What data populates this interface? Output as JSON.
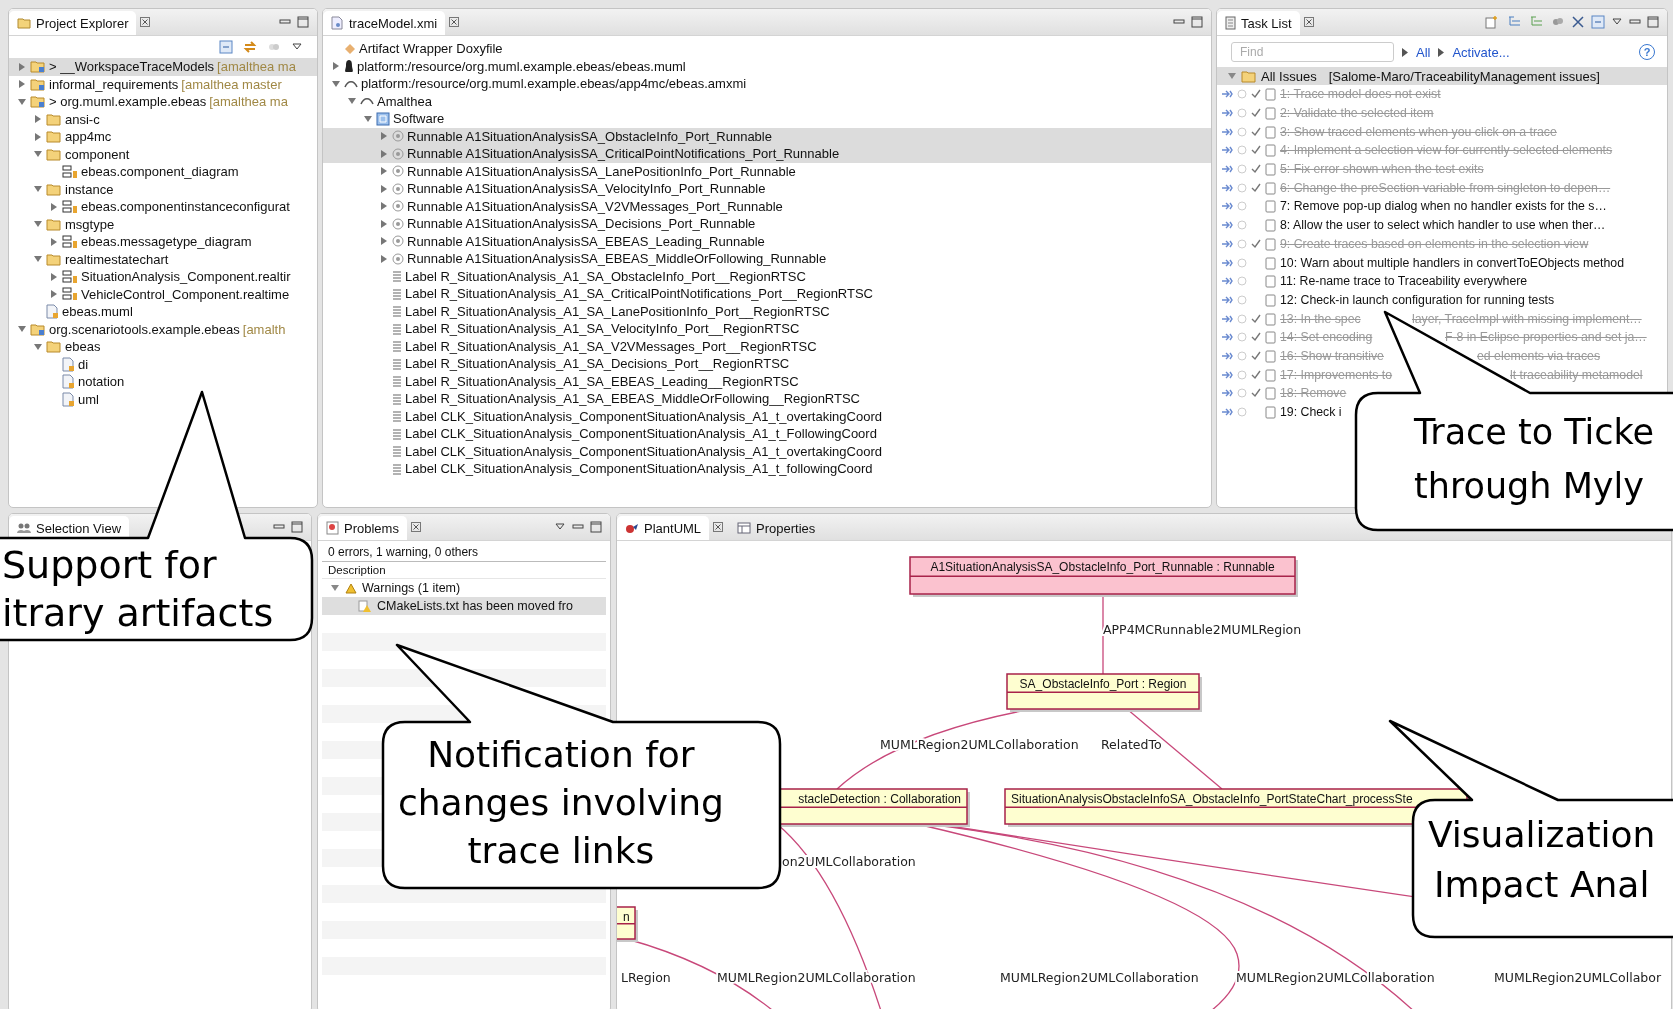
{
  "project_explorer": {
    "title": "Project Explorer",
    "items": [
      {
        "label": "> __WorkspaceTraceModels",
        "decoration": "[amalthea ma",
        "kind": "project",
        "expandable": true,
        "expanded": false,
        "selected": true
      },
      {
        "label": "informal_requirements",
        "decoration": "[amalthea master",
        "kind": "project",
        "expandable": true,
        "expanded": false,
        "selected": false
      },
      {
        "label": "> org.muml.example.ebeas",
        "decoration": "[amalthea ma",
        "kind": "project",
        "expandable": true,
        "expanded": true,
        "selected": false,
        "children": [
          {
            "label": "ansi-c",
            "kind": "folder",
            "expandable": true,
            "expanded": false,
            "selected": false
          },
          {
            "label": "app4mc",
            "kind": "folder",
            "expandable": true,
            "expanded": false,
            "selected": false
          },
          {
            "label": "component",
            "kind": "folder",
            "expandable": true,
            "expanded": true,
            "selected": false,
            "children": [
              {
                "label": "ebeas.component_diagram",
                "kind": "diagram",
                "expandable": false,
                "selected": false
              }
            ]
          },
          {
            "label": "instance",
            "kind": "folder",
            "expandable": true,
            "expanded": true,
            "selected": false,
            "children": [
              {
                "label": "ebeas.componentinstanceconfigurat",
                "kind": "diagram",
                "expandable": true,
                "expanded": false,
                "selected": false
              }
            ]
          },
          {
            "label": "msgtype",
            "kind": "folder",
            "expandable": true,
            "expanded": true,
            "selected": false,
            "children": [
              {
                "label": "ebeas.messagetype_diagram",
                "kind": "diagram",
                "expandable": true,
                "expanded": false,
                "selected": false
              }
            ]
          },
          {
            "label": "realtimestatechart",
            "kind": "folder",
            "expandable": true,
            "expanded": true,
            "selected": false,
            "children": [
              {
                "label": "SituationAnalysis_Component.realtir",
                "kind": "diagram",
                "expandable": true,
                "expanded": false,
                "selected": false
              },
              {
                "label": "VehicleControl_Component.realtime",
                "kind": "diagram",
                "expandable": true,
                "expanded": false,
                "selected": false
              }
            ]
          },
          {
            "label": "ebeas.muml",
            "kind": "file",
            "expandable": false,
            "selected": false
          }
        ]
      },
      {
        "label": "org.scenariotools.example.ebeas",
        "decoration": "[amalth",
        "kind": "project",
        "expandable": true,
        "expanded": true,
        "selected": false,
        "children": [
          {
            "label": "ebeas",
            "kind": "folder",
            "expandable": true,
            "expanded": true,
            "selected": false,
            "children": [
              {
                "label": "di",
                "kind": "file",
                "expandable": false,
                "selected": false
              },
              {
                "label": "notation",
                "kind": "file",
                "expandable": false,
                "selected": false
              },
              {
                "label": "uml",
                "kind": "file",
                "expandable": false,
                "selected": false
              }
            ]
          }
        ]
      }
    ]
  },
  "editor": {
    "tab": "traceModel.xmi",
    "items": [
      {
        "label": "Artifact Wrapper Doxyfile",
        "kind": "wrapper",
        "expandable": false,
        "selected": false
      },
      {
        "label": "platform:/resource/org.muml.example.ebeas/ebeas.muml",
        "kind": "resource",
        "expandable": true,
        "expanded": false,
        "selected": false
      },
      {
        "label": "platform:/resource/org.muml.example.ebeas/app4mc/ebeas.amxmi",
        "kind": "model",
        "expandable": true,
        "expanded": true,
        "selected": false,
        "children": [
          {
            "label": "Amalthea",
            "kind": "model",
            "expandable": true,
            "expanded": true,
            "selected": false,
            "children": [
              {
                "label": "Software",
                "kind": "package",
                "expandable": true,
                "expanded": true,
                "selected": false,
                "children": [
                  {
                    "label": "Runnable A1SituationAnalysisSA_ObstacleInfo_Port_Runnable",
                    "kind": "runnable",
                    "expandable": true,
                    "expanded": false,
                    "selected": true
                  },
                  {
                    "label": "Runnable A1SituationAnalysisSA_CriticalPointNotifications_Port_Runnable",
                    "kind": "runnable",
                    "expandable": true,
                    "expanded": false,
                    "selected": true
                  },
                  {
                    "label": "Runnable A1SituationAnalysisSA_LanePositionInfo_Port_Runnable",
                    "kind": "runnable",
                    "expandable": true,
                    "expanded": false,
                    "selected": false
                  },
                  {
                    "label": "Runnable A1SituationAnalysisSA_VelocityInfo_Port_Runnable",
                    "kind": "runnable",
                    "expandable": true,
                    "expanded": false,
                    "selected": false
                  },
                  {
                    "label": "Runnable A1SituationAnalysisSA_V2VMessages_Port_Runnable",
                    "kind": "runnable",
                    "expandable": true,
                    "expanded": false,
                    "selected": false
                  },
                  {
                    "label": "Runnable A1SituationAnalysisSA_Decisions_Port_Runnable",
                    "kind": "runnable",
                    "expandable": true,
                    "expanded": false,
                    "selected": false
                  },
                  {
                    "label": "Runnable A1SituationAnalysisSA_EBEAS_Leading_Runnable",
                    "kind": "runnable",
                    "expandable": true,
                    "expanded": false,
                    "selected": false
                  },
                  {
                    "label": "Runnable A1SituationAnalysisSA_EBEAS_MiddleOrFollowing_Runnable",
                    "kind": "runnable",
                    "expandable": true,
                    "expanded": false,
                    "selected": false
                  },
                  {
                    "label": "Label R_SituationAnalysis_A1_SA_ObstacleInfo_Port__RegionRTSC",
                    "kind": "label",
                    "expandable": false,
                    "selected": false
                  },
                  {
                    "label": "Label R_SituationAnalysis_A1_SA_CriticalPointNotifications_Port__RegionRTSC",
                    "kind": "label",
                    "expandable": false,
                    "selected": false
                  },
                  {
                    "label": "Label R_SituationAnalysis_A1_SA_LanePositionInfo_Port__RegionRTSC",
                    "kind": "label",
                    "expandable": false,
                    "selected": false
                  },
                  {
                    "label": "Label R_SituationAnalysis_A1_SA_VelocityInfo_Port__RegionRTSC",
                    "kind": "label",
                    "expandable": false,
                    "selected": false
                  },
                  {
                    "label": "Label R_SituationAnalysis_A1_SA_V2VMessages_Port__RegionRTSC",
                    "kind": "label",
                    "expandable": false,
                    "selected": false
                  },
                  {
                    "label": "Label R_SituationAnalysis_A1_SA_Decisions_Port__RegionRTSC",
                    "kind": "label",
                    "expandable": false,
                    "selected": false
                  },
                  {
                    "label": "Label R_SituationAnalysis_A1_SA_EBEAS_Leading__RegionRTSC",
                    "kind": "label",
                    "expandable": false,
                    "selected": false
                  },
                  {
                    "label": "Label R_SituationAnalysis_A1_SA_EBEAS_MiddleOrFollowing__RegionRTSC",
                    "kind": "label",
                    "expandable": false,
                    "selected": false
                  },
                  {
                    "label": "Label CLK_SituationAnalysis_ComponentSituationAnalysis_A1_t_overtakingCoord",
                    "kind": "label",
                    "expandable": false,
                    "selected": false
                  },
                  {
                    "label": "Label CLK_SituationAnalysis_ComponentSituationAnalysis_A1_t_FollowingCoord",
                    "kind": "label",
                    "expandable": false,
                    "selected": false
                  },
                  {
                    "label": "Label CLK_SituationAnalysis_ComponentSituationAnalysis_A1_t_overtakingCoord",
                    "kind": "label",
                    "expandable": false,
                    "selected": false
                  },
                  {
                    "label": "Label CLK_SituationAnalysis_ComponentSituationAnalysis_A1_t_followingCoord",
                    "kind": "label",
                    "expandable": false,
                    "selected": false
                  }
                ]
              }
            ]
          }
        ]
      }
    ]
  },
  "task_list": {
    "title": "Task List",
    "search": {
      "placeholder": "Find"
    },
    "links": [
      "All",
      "Activate..."
    ],
    "help": "?",
    "query": {
      "label": "All Issues",
      "repository": "[Salome-Maro/TraceabilityManagement issues]",
      "expanded": true
    },
    "tasks": [
      {
        "text": "1: Trace model does not exist",
        "done": true
      },
      {
        "text": "2: Validate the selected item",
        "done": true
      },
      {
        "text": "3: Show traced elements when you click on a trace",
        "done": true
      },
      {
        "text": "4: Implement a selection view for currently selected elements",
        "done": true
      },
      {
        "text": "5: Fix error shown when the test exits",
        "done": true
      },
      {
        "text": "6: Change the preSection variable from singleton to depen…",
        "done": true
      },
      {
        "text": "7: Remove pop-up dialog when no handler exists for the s…",
        "done": false
      },
      {
        "text": "8: Allow the user to select which handler to use when ther…",
        "done": false
      },
      {
        "text": "9: Create traces based on elements in the selection view",
        "done": true
      },
      {
        "text": "10: Warn about multiple handlers in convertToEObjects method",
        "done": false
      },
      {
        "text": "11: Re-name trace to Traceability everywhere",
        "done": false
      },
      {
        "text": "12: Check-in launch configuration for running tests",
        "done": false
      },
      {
        "text": "13: In the spec",
        "text_after": "layer, TraceImpl with missing implement…",
        "done": true
      },
      {
        "text": "14: Set encoding",
        "text_after": "F-8 in Eclipse properties and set ja…",
        "done": true
      },
      {
        "text": "16: Show transitive",
        "text_after": "ed elements via traces",
        "done": true
      },
      {
        "text": "17: Improvements to",
        "text_after": "lt traceability metamodel",
        "done": true
      },
      {
        "text": "18: Remove",
        "done": true
      },
      {
        "text": "19: Check i",
        "done": false
      }
    ]
  },
  "selection_view": {
    "title": "Selection View"
  },
  "problems": {
    "title": "Problems",
    "summary": "0 errors, 1 warning, 0 others",
    "column": "Description",
    "group": {
      "label": "Warnings (1 item)",
      "expanded": true
    },
    "items": [
      {
        "text": "CMakeLists.txt has been moved fro",
        "selected": true
      }
    ]
  },
  "diagram_view": {
    "tabs": [
      {
        "label": "PlantUML",
        "selected": true
      },
      {
        "label": "Properties",
        "selected": false
      }
    ],
    "nodes": [
      {
        "kind": "runnable",
        "label": "A1SituationAnalysisSA_ObstacleInfo_Port_Runnable : Runnable"
      },
      {
        "kind": "region",
        "label": "SA_ObstacleInfo_Port : Region"
      },
      {
        "kind": "collaboration",
        "label": "stacleDetection : Collaboration"
      },
      {
        "kind": "step",
        "label": "SituationAnalysisObstacleInfoSA_ObstacleInfo_PortStateChart_processSte"
      },
      {
        "kind": "partial",
        "label": "n"
      }
    ],
    "edge_labels": [
      "APP4MCRunnable2MUMLRegion",
      "MUMLRegion2UMLCollaboration",
      "RelatedTo",
      "on2UMLCollaboration",
      "LRegion",
      "MUMLRegion2UMLCollaboration",
      "MUMLRegion2UMLCollaboration",
      "MUMLRegion2UMLCollaboration",
      "MUMLRegion2UMLCollabor"
    ]
  },
  "callouts": [
    {
      "lines": [
        "Support for",
        "itrary artifacts"
      ]
    },
    {
      "lines": [
        "Notification for",
        "changes involving",
        "trace links"
      ]
    },
    {
      "lines": [
        "Trace to Ticke",
        "through Myly"
      ]
    },
    {
      "lines": [
        "Visualization",
        "Impact Anal"
      ]
    }
  ]
}
